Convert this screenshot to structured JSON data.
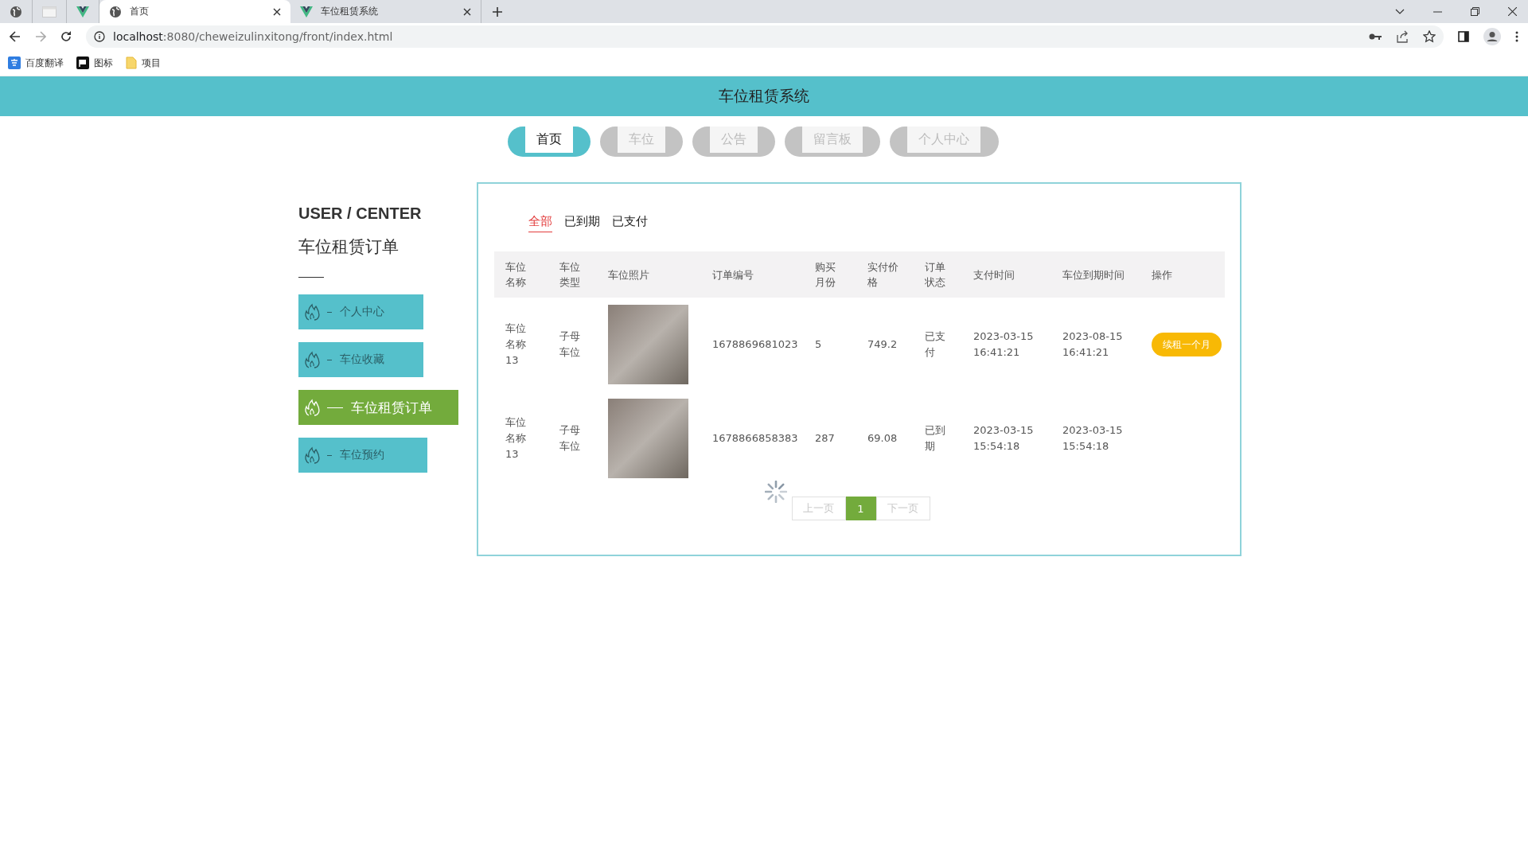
{
  "browser": {
    "tabs": [
      {
        "kind": "globe",
        "selected": false
      },
      {
        "kind": "blank",
        "selected": false
      },
      {
        "kind": "vue",
        "selected": false
      },
      {
        "kind": "globe",
        "title": "首页",
        "selected": true
      },
      {
        "kind": "vue",
        "title": "车位租赁系统",
        "selected": false
      }
    ],
    "address": {
      "host": "localhost",
      "rest": ":8080/cheweizulinxitong/front/index.html"
    },
    "bookmarks": [
      {
        "kind": "translate",
        "label": "百度翻译"
      },
      {
        "kind": "flag",
        "label": "图标"
      },
      {
        "kind": "folder",
        "label": "项目"
      }
    ]
  },
  "header": {
    "title": "车位租赁系统"
  },
  "nav": [
    {
      "label": "首页",
      "selected": true
    },
    {
      "label": "车位",
      "selected": false
    },
    {
      "label": "公告",
      "selected": false
    },
    {
      "label": "留言板",
      "selected": false
    },
    {
      "label": "个人中心",
      "selected": false
    }
  ],
  "sidebar": {
    "heading": "USER / CENTER",
    "subtitle": "车位租赁订单",
    "items": [
      {
        "label": "个人中心",
        "selected": false
      },
      {
        "label": "车位收藏",
        "selected": false
      },
      {
        "label": "车位租赁订单",
        "selected": true
      },
      {
        "label": "车位预约",
        "selected": false
      }
    ]
  },
  "filters": [
    {
      "label": "全部",
      "selected": true
    },
    {
      "label": "已到期",
      "selected": false
    },
    {
      "label": "已支付",
      "selected": false
    }
  ],
  "table": {
    "columns": [
      "车位名称",
      "车位类型",
      "车位照片",
      "订单编号",
      "购买月份",
      "实付价格",
      "订单状态",
      "支付时间",
      "车位到期时间",
      "操作"
    ],
    "rows": [
      {
        "name": "车位名称13",
        "type": "子母车位",
        "order_no": "1678869681023",
        "months": "5",
        "price": "749.2",
        "status": "已支付",
        "paid_at": "2023-03-15 16:41:21",
        "expires_at": "2023-08-15 16:41:21",
        "action": "续租一个月"
      },
      {
        "name": "车位名称13",
        "type": "子母车位",
        "order_no": "1678866858383",
        "months": "287",
        "price": "69.08",
        "status": "已到期",
        "paid_at": "2023-03-15 15:54:18",
        "expires_at": "2023-03-15 15:54:18"
      }
    ]
  },
  "pagination": {
    "prev": "上一页",
    "pages": [
      {
        "label": "1",
        "selected": true
      }
    ],
    "next": "下一页"
  }
}
